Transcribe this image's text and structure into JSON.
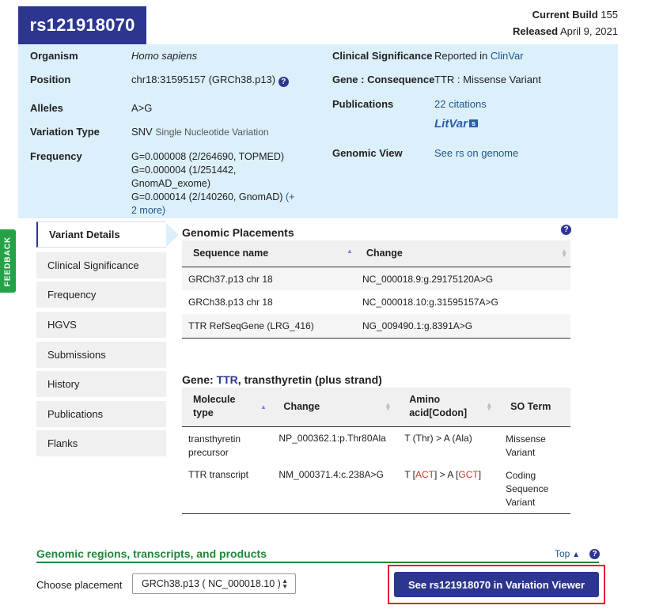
{
  "header": {
    "rs_id": "rs121918070",
    "current_build_label": "Current Build",
    "current_build_value": "155",
    "released_label": "Released",
    "released_value": "April 9, 2021"
  },
  "summary": {
    "organism_label": "Organism",
    "organism_value": "Homo sapiens",
    "position_label": "Position",
    "position_value": "chr18:31595157 (GRCh38.p13)",
    "alleles_label": "Alleles",
    "alleles_value": "A>G",
    "variation_type_label": "Variation Type",
    "variation_type_value": "SNV",
    "variation_type_desc": "Single Nucleotide Variation",
    "frequency_label": "Frequency",
    "frequency_lines": [
      "G=0.000008 (2/264690, TOPMED)",
      "G=0.000004 (1/251442, GnomAD_exome)",
      "G=0.000014 (2/140260, GnomAD)"
    ],
    "frequency_more": "(+ 2 more)",
    "clinical_label": "Clinical Significance",
    "clinical_value": "Reported in",
    "clinical_link": "ClinVar",
    "gene_label": "Gene : Consequence",
    "gene_value": "TTR : Missense Variant",
    "publications_label": "Publications",
    "publications_link": "22 citations",
    "litvar_text": "LitVar",
    "litvar_badge": "s",
    "genomic_view_label": "Genomic View",
    "genomic_view_link": "See rs on genome"
  },
  "feedback": "FEEDBACK",
  "nav": {
    "items": [
      "Variant Details",
      "Clinical Significance",
      "Frequency",
      "HGVS",
      "Submissions",
      "History",
      "Publications",
      "Flanks"
    ]
  },
  "placements": {
    "title": "Genomic Placements",
    "columns": [
      "Sequence name",
      "Change"
    ],
    "rows": [
      [
        "GRCh37.p13 chr 18",
        "NC_000018.9:g.29175120A>G"
      ],
      [
        "GRCh38.p13 chr 18",
        "NC_000018.10:g.31595157A>G"
      ],
      [
        "TTR RefSeqGene (LRG_416)",
        "NG_009490.1:g.8391A>G"
      ]
    ]
  },
  "gene": {
    "title_prefix": "Gene:",
    "title_gene": "TTR",
    "title_suffix": ", transthyretin (plus strand)",
    "columns": [
      "Molecule type",
      "Change",
      "Amino acid[Codon]",
      "SO Term"
    ],
    "rows": [
      {
        "molecule": "transthyretin precursor",
        "change": "NP_000362.1:p.Thr80Ala",
        "amino": "T (Thr) > A (Ala)",
        "so": "Missense Variant"
      },
      {
        "molecule": "TTR transcript",
        "change": "NM_000371.4:c.238A>G",
        "amino_pre": "T [",
        "amino_codon1": "ACT",
        "amino_mid": "] > A [",
        "amino_codon2": "GCT",
        "amino_post": "]",
        "so": "Coding Sequence Variant"
      }
    ]
  },
  "footer": {
    "regions_title": "Genomic regions, transcripts, and products",
    "top_link": "Top",
    "choose_label": "Choose placement",
    "placement_selected": "GRCh38.p13 ( NC_000018.10 )",
    "viewer_button": "See rs121918070 in Variation Viewer"
  },
  "colors": {
    "brand": "#2c3690",
    "panel_bg": "#dcf0fb",
    "feedback": "#25a247",
    "section_green": "#21873a",
    "highlight_border": "#e0182b"
  }
}
